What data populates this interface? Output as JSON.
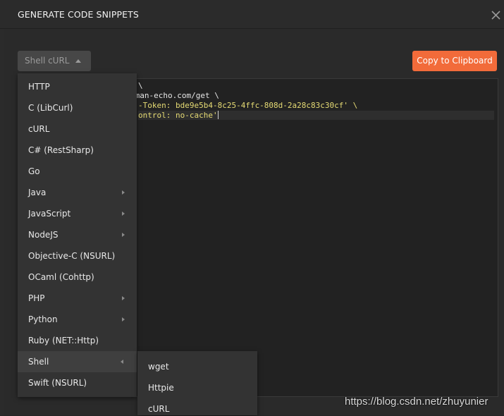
{
  "header": {
    "title": "GENERATE CODE SNIPPETS"
  },
  "language_select": {
    "value": "Shell cURL"
  },
  "copy_button": {
    "label": "Copy to Clipboard"
  },
  "code": {
    "lines": [
      "\\",
      "tman-echo.com/get \\",
      "-Token: bde9e5b4-8c25-4ffc-808d-2a28c83c30cf' \\",
      "ontrol: no-cache'"
    ]
  },
  "menu": {
    "items": [
      {
        "label": "HTTP",
        "has_submenu": false
      },
      {
        "label": "C (LibCurl)",
        "has_submenu": false
      },
      {
        "label": "cURL",
        "has_submenu": false
      },
      {
        "label": "C# (RestSharp)",
        "has_submenu": false
      },
      {
        "label": "Go",
        "has_submenu": false
      },
      {
        "label": "Java",
        "has_submenu": true
      },
      {
        "label": "JavaScript",
        "has_submenu": true
      },
      {
        "label": "NodeJS",
        "has_submenu": true
      },
      {
        "label": "Objective-C (NSURL)",
        "has_submenu": false
      },
      {
        "label": "OCaml (Cohttp)",
        "has_submenu": false
      },
      {
        "label": "PHP",
        "has_submenu": true
      },
      {
        "label": "Python",
        "has_submenu": true
      },
      {
        "label": "Ruby (NET::Http)",
        "has_submenu": false
      },
      {
        "label": "Shell",
        "has_submenu": true,
        "active": true
      },
      {
        "label": "Swift (NSURL)",
        "has_submenu": false
      }
    ]
  },
  "submenu": {
    "items": [
      {
        "label": "wget"
      },
      {
        "label": "Httpie"
      },
      {
        "label": "cURL"
      }
    ]
  },
  "watermark": {
    "text": "https://blog.csdn.net/zhuyunier"
  },
  "colors": {
    "accent": "#f26b3a",
    "background": "#2b2b2b",
    "menu": "#333333"
  }
}
